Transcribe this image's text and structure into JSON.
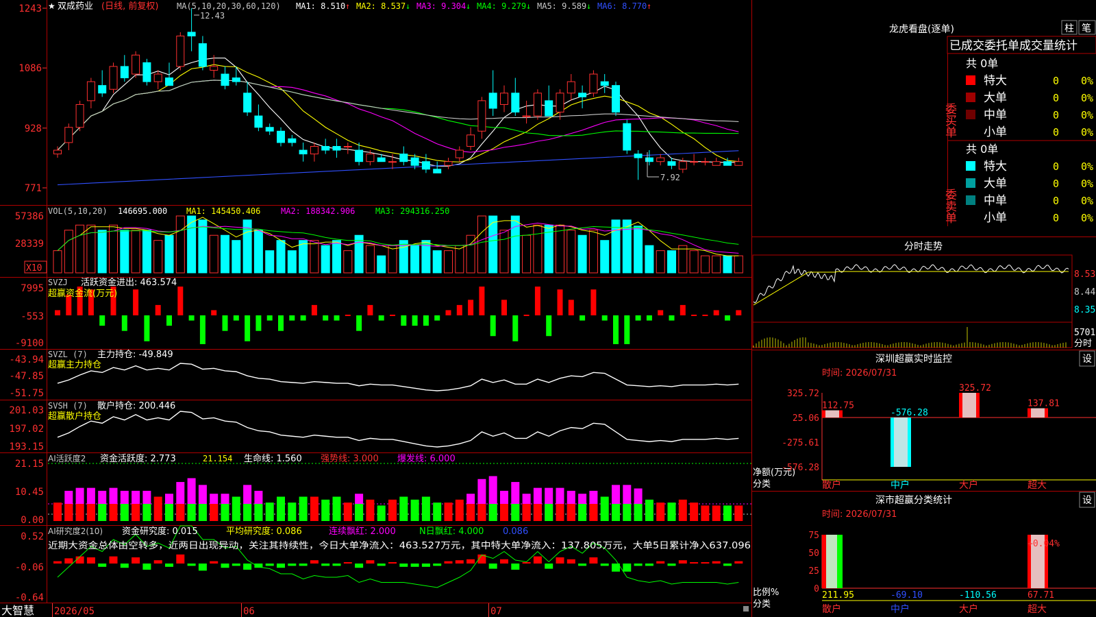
{
  "stock": {
    "name": "双成药业",
    "mode": "(日线, 前复权)",
    "star": "★"
  },
  "ma_header": {
    "label": "MA(5,10,20,30,60,120)",
    "items": [
      {
        "label": "MA1: 8.510",
        "arrow": "↑",
        "color": "#ffffff"
      },
      {
        "label": "MA2: 8.537",
        "arrow": "↓",
        "color": "#ffff00"
      },
      {
        "label": "MA3: 9.304",
        "arrow": "↓",
        "color": "#ff00ff"
      },
      {
        "label": "MA4: 9.279",
        "arrow": "↓",
        "color": "#00ff00"
      },
      {
        "label": "MA5: 9.589",
        "arrow": "↓",
        "color": "#c8c8c8"
      },
      {
        "label": "MA6: 8.770",
        "arrow": "↑",
        "color": "#3050ff"
      }
    ]
  },
  "price_axis": [
    "1243",
    "1086",
    "928",
    "771"
  ],
  "price_annotations": {
    "high": "12.43",
    "low": "7.92"
  },
  "vol_panel": {
    "title": "VOL(5,10,20)",
    "value": "146695.000",
    "ma1": "MA1: 145450.406",
    "ma2": "MA2: 188342.906",
    "ma3": "MA3: 294316.250",
    "axis": [
      "57386",
      "28339"
    ],
    "unit": "X10"
  },
  "svzj_panel": {
    "title": "SVZJ",
    "label": "活跃资金进出: 463.574",
    "subtitle": "超赢资金流(万元)",
    "axis": [
      "7995",
      "-553",
      "-9100"
    ]
  },
  "svzl_panel": {
    "title": "SVZL (7)",
    "label": "主力持仓: -49.849",
    "subtitle": "超赢主力持仓",
    "axis": [
      "-43.94",
      "-47.85",
      "-51.75"
    ]
  },
  "svsh_panel": {
    "title": "SVSH (7)",
    "label": "散户持仓: 200.446",
    "subtitle": "超赢散户持仓",
    "axis": [
      "201.03",
      "197.02",
      "193.15"
    ]
  },
  "ai_active_panel": {
    "title": "AI活跃度2",
    "label": "资金活跃度: 2.773",
    "v2": "21.154",
    "life": "生命线: 1.560",
    "strong": "强势线: 3.000",
    "burst": "爆发线: 6.000",
    "axis": [
      "21.15",
      "10.45",
      "0.00"
    ]
  },
  "ai_research_panel": {
    "title": "AI研究度2(10)",
    "label": "资金研究度: 0.015",
    "avg": "平均研究度: 0.086",
    "red1": "连续飘红: 2.000",
    "red2": "N日飘红: 4.000",
    "v5": "0.086",
    "axis": [
      "0.52",
      "-0.06",
      "-0.64"
    ],
    "note": "近期大资金总体由空转多，近两日出现异动，关注其持续性，今日大单净流入：463.527万元，其中特大单净流入：137.805万元，大单5日累计净入637.096"
  },
  "date_axis": {
    "brand": "大智慧",
    "labels": [
      "2026/05",
      "06",
      "07"
    ]
  },
  "dragon_panel": {
    "title": "龙虎看盘(逐单)",
    "tabs": [
      "柱",
      "笔"
    ],
    "heading": "已成交委托单成交量统计",
    "buy": {
      "label": "委买单",
      "total": "共 0单",
      "rows": [
        {
          "name": "特大",
          "count": "0",
          "pct": "0%",
          "color": "#ff0000"
        },
        {
          "name": "大单",
          "count": "0",
          "pct": "0%",
          "color": "#a00000"
        },
        {
          "name": "中单",
          "count": "0",
          "pct": "0%",
          "color": "#700000"
        },
        {
          "name": "小单",
          "count": "0",
          "pct": "0%",
          "color": ""
        }
      ]
    },
    "sell": {
      "label": "委卖单",
      "total": "共 0单",
      "rows": [
        {
          "name": "特大",
          "count": "0",
          "pct": "0%",
          "color": "#00ffff"
        },
        {
          "name": "大单",
          "count": "0",
          "pct": "0%",
          "color": "#00a0a0"
        },
        {
          "name": "中单",
          "count": "0",
          "pct": "0%",
          "color": "#008080"
        },
        {
          "name": "小单",
          "count": "0",
          "pct": "0%",
          "color": ""
        }
      ]
    }
  },
  "intraday_panel": {
    "title": "分时走势",
    "axis": [
      "8.53",
      "8.44",
      "8.35"
    ],
    "vol": "5701",
    "vol_unit": "分时"
  },
  "sz_monitor": {
    "title": "深圳超赢实时监控",
    "settings": "设",
    "time": "时间: 2026/07/31",
    "axis": [
      "325.72",
      "25.06",
      "-275.61",
      "-576.28"
    ],
    "ylabel": "净额(万元)",
    "xlabel": "分类",
    "categories": [
      "散户",
      "中户",
      "大户",
      "超大"
    ],
    "values": [
      "112.75",
      "-576.28",
      "325.72",
      "137.81"
    ]
  },
  "sz_classify": {
    "title": "深市超赢分类统计",
    "settings": "设",
    "time": "时间: 2026/07/31",
    "axis": [
      "75",
      "50",
      "25",
      "0"
    ],
    "ylabel": "比例%",
    "xlabel": "分类",
    "categories": [
      "散户",
      "中户",
      "大户",
      "超大"
    ],
    "values": [
      "211.95",
      "-69.10",
      "-110.56",
      "67.71"
    ],
    "annot": "+0.04%"
  },
  "chart_data": [
    {
      "type": "candlestick",
      "title": "双成药业",
      "ylim": [
        7.71,
        12.43
      ],
      "dates": [
        "2026/05",
        "06",
        "07"
      ],
      "ohlc": [
        [
          8.6,
          8.8,
          8.5,
          8.7
        ],
        [
          8.9,
          9.4,
          8.7,
          9.3
        ],
        [
          9.3,
          10.0,
          9.2,
          9.9
        ],
        [
          10.0,
          10.6,
          9.8,
          10.5
        ],
        [
          10.4,
          10.8,
          10.1,
          10.2
        ],
        [
          10.3,
          11.0,
          10.2,
          10.9
        ],
        [
          10.9,
          11.2,
          10.5,
          10.6
        ],
        [
          10.7,
          11.3,
          10.6,
          11.2
        ],
        [
          11.0,
          11.1,
          10.4,
          10.5
        ],
        [
          10.5,
          10.8,
          10.3,
          10.7
        ],
        [
          10.6,
          11.0,
          10.4,
          10.4
        ],
        [
          10.9,
          11.8,
          10.8,
          11.7
        ],
        [
          11.8,
          12.43,
          11.3,
          11.7
        ],
        [
          11.5,
          11.7,
          10.8,
          10.9
        ],
        [
          10.8,
          11.2,
          10.6,
          10.9
        ],
        [
          10.7,
          10.9,
          10.3,
          10.4
        ],
        [
          10.6,
          10.9,
          10.4,
          10.5
        ],
        [
          10.2,
          10.5,
          9.6,
          9.7
        ],
        [
          9.6,
          9.9,
          9.2,
          9.3
        ],
        [
          9.3,
          9.4,
          9.1,
          9.2
        ],
        [
          9.2,
          9.3,
          8.8,
          8.9
        ],
        [
          9.0,
          9.1,
          8.8,
          8.9
        ],
        [
          8.7,
          8.9,
          8.4,
          8.6
        ],
        [
          8.6,
          8.9,
          8.4,
          8.8
        ],
        [
          8.8,
          9.0,
          8.6,
          8.7
        ],
        [
          8.8,
          9.0,
          8.5,
          8.7
        ],
        [
          8.8,
          8.9,
          8.6,
          8.8
        ],
        [
          8.7,
          8.9,
          8.3,
          8.4
        ],
        [
          8.4,
          8.7,
          8.3,
          8.6
        ],
        [
          8.5,
          8.6,
          8.4,
          8.4
        ],
        [
          8.4,
          8.6,
          8.2,
          8.4
        ],
        [
          8.6,
          8.8,
          8.3,
          8.4
        ],
        [
          8.5,
          8.6,
          8.2,
          8.3
        ],
        [
          8.4,
          8.6,
          8.1,
          8.2
        ],
        [
          8.2,
          8.4,
          8.1,
          8.1
        ],
        [
          8.3,
          8.5,
          8.2,
          8.4
        ],
        [
          8.5,
          8.8,
          8.4,
          8.7
        ],
        [
          8.8,
          9.3,
          8.7,
          9.1
        ],
        [
          9.2,
          10.1,
          9.0,
          10.0
        ],
        [
          10.2,
          10.8,
          9.6,
          9.8
        ],
        [
          9.9,
          10.4,
          9.7,
          10.2
        ],
        [
          10.2,
          10.6,
          9.6,
          9.7
        ],
        [
          9.6,
          10.0,
          9.4,
          9.6
        ],
        [
          9.6,
          10.3,
          9.5,
          10.2
        ],
        [
          10.0,
          10.4,
          9.6,
          9.6
        ],
        [
          9.7,
          10.3,
          9.5,
          10.2
        ],
        [
          10.2,
          10.7,
          10.0,
          10.5
        ],
        [
          10.2,
          10.4,
          9.8,
          10.1
        ],
        [
          10.2,
          10.8,
          10.1,
          10.7
        ],
        [
          10.5,
          10.7,
          10.2,
          10.4
        ],
        [
          10.4,
          10.5,
          9.6,
          9.7
        ],
        [
          9.4,
          9.5,
          8.6,
          8.7
        ],
        [
          8.6,
          8.7,
          7.92,
          8.5
        ],
        [
          8.5,
          8.7,
          8.3,
          8.4
        ],
        [
          8.4,
          8.6,
          8.3,
          8.5
        ],
        [
          8.4,
          8.5,
          8.2,
          8.3
        ],
        [
          8.2,
          8.5,
          8.1,
          8.4
        ],
        [
          8.4,
          8.6,
          8.3,
          8.4
        ],
        [
          8.4,
          8.5,
          8.3,
          8.4
        ],
        [
          8.3,
          8.5,
          8.3,
          8.4
        ],
        [
          8.4,
          8.5,
          8.3,
          8.3
        ],
        [
          8.3,
          8.5,
          8.3,
          8.4
        ]
      ]
    },
    {
      "type": "bar",
      "title": "VOL",
      "ylim": [
        0,
        57386
      ]
    },
    {
      "type": "bar",
      "title": "SVZJ",
      "ylim": [
        -9100,
        7995
      ]
    },
    {
      "type": "line",
      "title": "SVZL",
      "ylim": [
        -51.75,
        -43.94
      ]
    },
    {
      "type": "line",
      "title": "SVSH",
      "ylim": [
        193.15,
        201.03
      ]
    },
    {
      "type": "bar",
      "title": "AI活跃度2",
      "ylim": [
        0,
        21.15
      ]
    },
    {
      "type": "bar",
      "title": "AI研究度2",
      "ylim": [
        -0.64,
        0.52
      ]
    },
    {
      "type": "bar",
      "title": "深圳超赢实时监控",
      "categories": [
        "散户",
        "中户",
        "大户",
        "超大"
      ],
      "values": [
        112.75,
        -576.28,
        325.72,
        137.81
      ],
      "ylim": [
        -576.28,
        325.72
      ]
    },
    {
      "type": "bar",
      "title": "深市超赢分类统计",
      "categories": [
        "散户",
        "中户",
        "大户",
        "超大"
      ],
      "values": [
        211.95,
        -69.1,
        -110.56,
        67.71
      ],
      "ylim": [
        0,
        75
      ]
    }
  ]
}
